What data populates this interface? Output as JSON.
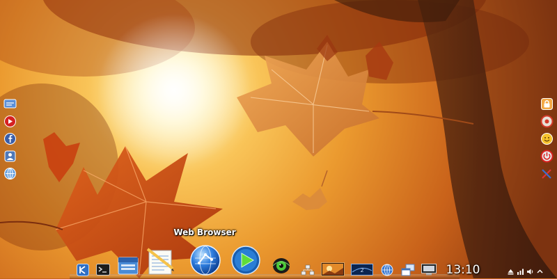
{
  "desktop": {
    "wallpaper": "autumn-leaves-sunlight",
    "colors": {
      "sky_glow": "#fff2c0",
      "orange": "#e98a24",
      "deep_orange": "#b94a10",
      "trunk": "#3a1d0e"
    }
  },
  "left_launchers": [
    {
      "icon": "messenger-icon"
    },
    {
      "icon": "youtube-icon"
    },
    {
      "icon": "facebook-icon"
    },
    {
      "icon": "contacts-icon"
    },
    {
      "icon": "network-icon"
    }
  ],
  "right_launchers": [
    {
      "icon": "lock-icon"
    },
    {
      "icon": "settings-icon"
    },
    {
      "icon": "smiley-icon"
    },
    {
      "icon": "power-icon"
    },
    {
      "icon": "tools-icon"
    }
  ],
  "dock": {
    "tooltip": "Web Browser",
    "items": [
      {
        "icon": "kde-menu-icon"
      },
      {
        "icon": "terminal-icon"
      },
      {
        "icon": "file-manager-icon"
      },
      {
        "icon": "text-editor-icon"
      },
      {
        "icon": "web-browser-icon"
      },
      {
        "icon": "media-player-icon"
      },
      {
        "icon": "system-monitor-icon"
      },
      {
        "icon": "network-manager-icon"
      },
      {
        "icon": "photo-viewer-icon"
      },
      {
        "icon": "virtual-desktop-icon"
      },
      {
        "icon": "globe-icon"
      },
      {
        "icon": "window-list-icon"
      },
      {
        "icon": "screen-icon"
      }
    ],
    "clock": "13:10",
    "tray": [
      {
        "icon": "tray-eject-icon"
      },
      {
        "icon": "tray-network-icon"
      },
      {
        "icon": "tray-volume-icon"
      },
      {
        "icon": "tray-expand-icon"
      }
    ]
  }
}
